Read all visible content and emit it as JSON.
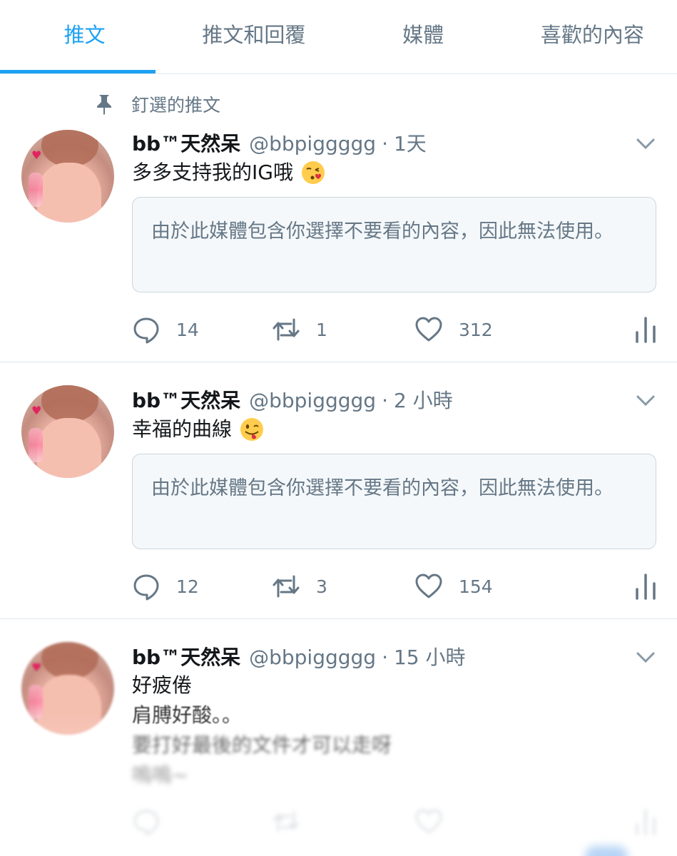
{
  "tabs": [
    {
      "label": "推文",
      "active": true
    },
    {
      "label": "推文和回覆",
      "active": false
    },
    {
      "label": "媒體",
      "active": false
    },
    {
      "label": "喜歡的內容",
      "active": false
    }
  ],
  "pinned_label": "釘選的推文",
  "media_notice": "由於此媒體包含你選擇不要看的內容，因此無法使用。",
  "colors": {
    "accent": "#1da1f2",
    "secondary_text": "#657786",
    "border": "#e1e8ed",
    "notice_bg": "#f5f8fa"
  },
  "tweets": [
    {
      "name": "bb™天然呆",
      "handle": "@bbpiggggg",
      "separator": "·",
      "time": "1天",
      "text": "多多支持我的IG哦",
      "emoji": "face-blowing-kiss",
      "replies": "14",
      "retweets": "1",
      "likes": "312"
    },
    {
      "name": "bb™天然呆",
      "handle": "@bbpiggggg",
      "separator": "·",
      "time": "2 小時",
      "text": "幸福的曲線",
      "emoji": "winking-face-with-tongue",
      "replies": "12",
      "retweets": "3",
      "likes": "154"
    },
    {
      "name": "bb™天然呆",
      "handle": "@bbpiggggg",
      "separator": "·",
      "time": "15 小時",
      "lines": [
        "好疲倦",
        "肩膊好酸。。",
        "要打好最後的文件才可以走呀",
        "嗚嗚~"
      ]
    }
  ],
  "icons": {
    "pin": "pin-icon",
    "chevron": "chevron-down-icon",
    "reply": "reply-icon",
    "retweet": "retweet-icon",
    "like": "heart-icon",
    "stats": "analytics-icon"
  }
}
